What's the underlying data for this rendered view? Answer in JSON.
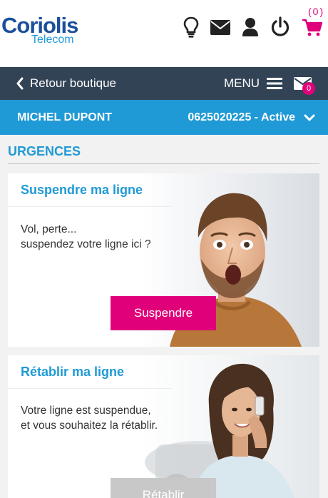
{
  "header": {
    "logo_main": "Coriolis",
    "logo_sub": "Telecom",
    "icons": [
      "lightbulb-icon",
      "mail-icon",
      "user-icon",
      "power-icon",
      "cart-icon"
    ],
    "cart_count": "(0)"
  },
  "nav": {
    "back_label": "Retour boutique",
    "menu_label": "MENU",
    "message_count": "0"
  },
  "user": {
    "name": "MICHEL DUPONT",
    "line": "0625020225 - Active"
  },
  "section": {
    "title": "URGENCES"
  },
  "cards": {
    "suspend": {
      "title": "Suspendre ma ligne",
      "text_line1": "Vol, perte...",
      "text_line2": "suspendez votre ligne ici ?",
      "button": "Suspendre"
    },
    "restore": {
      "title": "Rétablir ma ligne",
      "text_line1": "Votre ligne est suspendue,",
      "text_line2": "et vous souhaitez la rétablir.",
      "button": "Rétablir"
    }
  },
  "colors": {
    "brand_dark": "#1b4f9c",
    "brand_blue": "#1f9ad6",
    "accent_pink": "#e0007a",
    "nav_bg": "#334356"
  }
}
